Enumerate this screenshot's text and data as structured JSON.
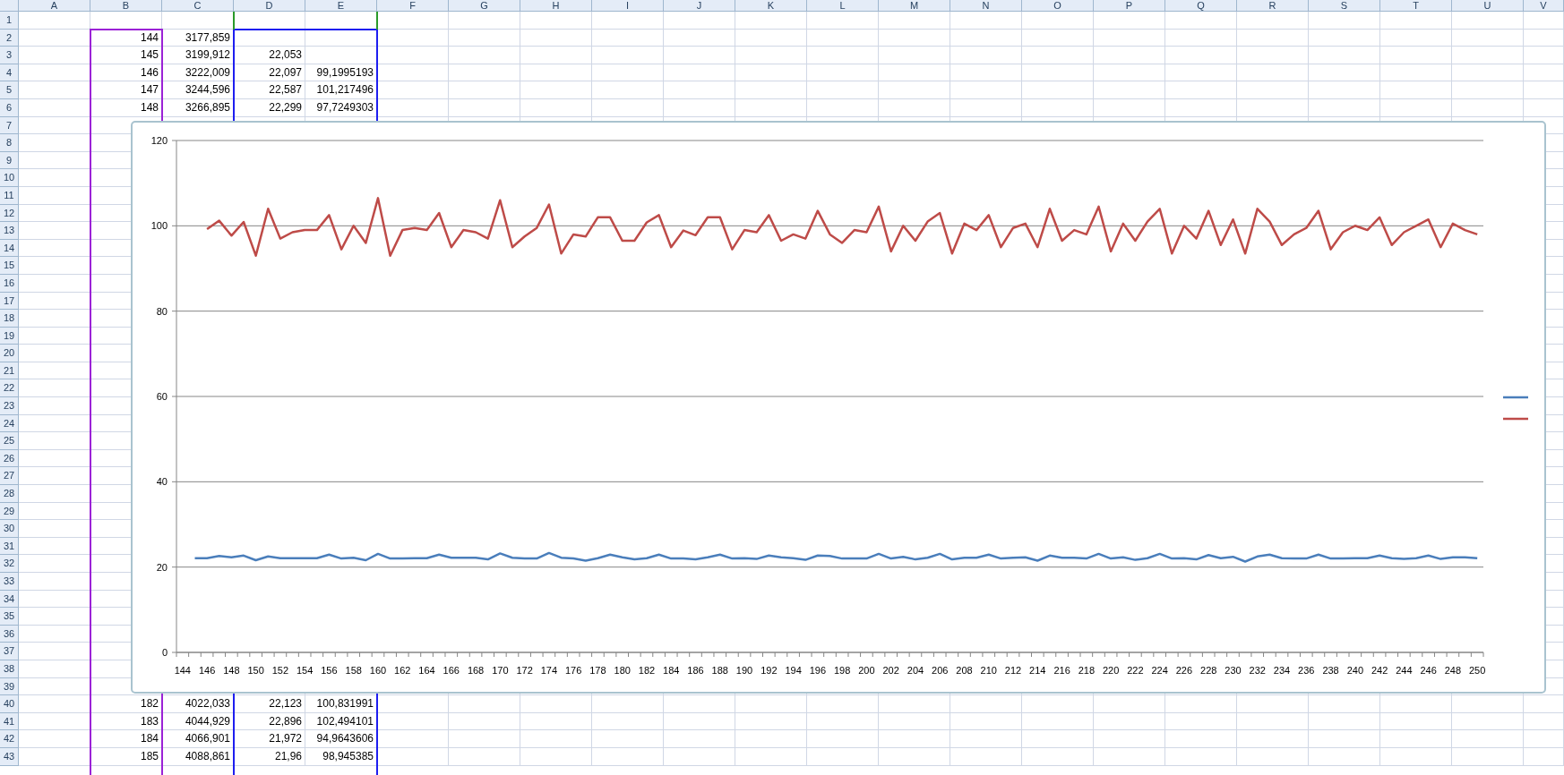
{
  "sheet": {
    "column_headers": [
      "A",
      "B",
      "C",
      "D",
      "E",
      "F",
      "G",
      "H",
      "I",
      "J",
      "K",
      "L",
      "M",
      "N",
      "O",
      "P",
      "Q",
      "R",
      "S",
      "T",
      "U",
      "V"
    ],
    "rows": [
      {
        "header": "1"
      },
      {
        "header": "2",
        "cells": [
          null,
          "144",
          "3177,859"
        ]
      },
      {
        "header": "3",
        "cells": [
          null,
          "145",
          "3199,912",
          "22,053"
        ]
      },
      {
        "header": "4",
        "cells": [
          null,
          "146",
          "3222,009",
          "22,097",
          "99,1995193"
        ]
      },
      {
        "header": "5",
        "cells": [
          null,
          "147",
          "3244,596",
          "22,587",
          "101,217496"
        ]
      },
      {
        "header": "6",
        "cells": [
          null,
          "148",
          "3266,895",
          "22,299",
          "97,7249303"
        ]
      },
      {
        "header": "7"
      },
      {
        "header": "8"
      },
      {
        "header": "9"
      },
      {
        "header": "10"
      },
      {
        "header": "11"
      },
      {
        "header": "12"
      },
      {
        "header": "13"
      },
      {
        "header": "14"
      },
      {
        "header": "15"
      },
      {
        "header": "16"
      },
      {
        "header": "17"
      },
      {
        "header": "18"
      },
      {
        "header": "19"
      },
      {
        "header": "20"
      },
      {
        "header": "21"
      },
      {
        "header": "22"
      },
      {
        "header": "23"
      },
      {
        "header": "24"
      },
      {
        "header": "25"
      },
      {
        "header": "26"
      },
      {
        "header": "27"
      },
      {
        "header": "28"
      },
      {
        "header": "29"
      },
      {
        "header": "30"
      },
      {
        "header": "31"
      },
      {
        "header": "32"
      },
      {
        "header": "33"
      },
      {
        "header": "34"
      },
      {
        "header": "35"
      },
      {
        "header": "36"
      },
      {
        "header": "37"
      },
      {
        "header": "38"
      },
      {
        "header": "39"
      },
      {
        "header": "40",
        "cells": [
          null,
          "182",
          "4022,033",
          "22,123",
          "100,831991"
        ]
      },
      {
        "header": "41",
        "cells": [
          null,
          "183",
          "4044,929",
          "22,896",
          "102,494101"
        ]
      },
      {
        "header": "42",
        "cells": [
          null,
          "184",
          "4066,901",
          "21,972",
          "94,9643606"
        ]
      },
      {
        "header": "43",
        "cells": [
          null,
          "185",
          "4088,861",
          "21,96",
          "98,945385"
        ]
      }
    ]
  },
  "chart": {
    "chart_data": {
      "type": "line",
      "grid": true,
      "xlim": [
        144,
        250
      ],
      "xticks": [
        144,
        146,
        148,
        150,
        152,
        154,
        156,
        158,
        160,
        162,
        164,
        166,
        168,
        170,
        172,
        174,
        176,
        178,
        180,
        182,
        184,
        186,
        188,
        190,
        192,
        194,
        196,
        198,
        200,
        202,
        204,
        206,
        208,
        210,
        212,
        214,
        216,
        218,
        220,
        222,
        224,
        226,
        228,
        230,
        232,
        234,
        236,
        238,
        240,
        242,
        244,
        246,
        248,
        250
      ],
      "x": [
        145,
        146,
        147,
        148,
        149,
        150,
        151,
        152,
        153,
        154,
        155,
        156,
        157,
        158,
        159,
        160,
        161,
        162,
        163,
        164,
        165,
        166,
        167,
        168,
        169,
        170,
        171,
        172,
        173,
        174,
        175,
        176,
        177,
        178,
        179,
        180,
        181,
        182,
        183,
        184,
        185,
        186,
        187,
        188,
        189,
        190,
        191,
        192,
        193,
        194,
        195,
        196,
        197,
        198,
        199,
        200,
        201,
        202,
        203,
        204,
        205,
        206,
        207,
        208,
        209,
        210,
        211,
        212,
        213,
        214,
        215,
        216,
        217,
        218,
        219,
        220,
        221,
        222,
        223,
        224,
        225,
        226,
        227,
        228,
        229,
        230,
        231,
        232,
        233,
        234,
        235,
        236,
        237,
        238,
        239,
        240,
        241,
        242,
        243,
        244,
        245,
        246,
        247,
        248,
        249,
        250
      ],
      "ylim": [
        0,
        120
      ],
      "yticks": [
        0,
        20,
        40,
        60,
        80,
        100,
        120
      ],
      "series": [
        {
          "color": "#4a7ebb",
          "values": [
            22.1,
            22.1,
            22.6,
            22.3,
            22.7,
            21.6,
            22.5,
            22.1,
            22.1,
            22.1,
            22.1,
            22.9,
            22.0,
            22.2,
            21.6,
            23.1,
            22.0,
            22.0,
            22.1,
            22.1,
            22.9,
            22.2,
            22.2,
            22.2,
            21.8,
            23.2,
            22.2,
            22.0,
            22.0,
            23.3,
            22.2,
            22.0,
            21.5,
            22.1,
            22.9,
            22.3,
            21.8,
            22.1,
            22.9,
            22.0,
            22.0,
            21.8,
            22.3,
            22.9,
            22.0,
            22.1,
            21.9,
            22.7,
            22.3,
            22.1,
            21.7,
            22.7,
            22.6,
            22.0,
            22.0,
            22.0,
            23.1,
            22.0,
            22.4,
            21.8,
            22.2,
            23.1,
            21.8,
            22.2,
            22.2,
            22.9,
            22.0,
            22.2,
            22.3,
            21.5,
            22.7,
            22.2,
            22.2,
            22.0,
            23.1,
            22.0,
            22.3,
            21.7,
            22.1,
            23.1,
            22.0,
            22.1,
            21.8,
            22.8,
            22.1,
            22.4,
            21.3,
            22.5,
            22.9,
            22.1,
            22.0,
            22.0,
            22.9,
            22.0,
            22.0,
            22.1,
            22.1,
            22.7,
            22.1,
            21.9,
            22.1,
            22.7,
            21.9,
            22.3,
            22.3,
            22.1
          ]
        },
        {
          "color": "#be4b48",
          "values": [
            null,
            99.2,
            101.2,
            97.7,
            100.9,
            93,
            104,
            97,
            98.5,
            99,
            99,
            102.5,
            94.5,
            100,
            96,
            106.5,
            93,
            99,
            99.5,
            99,
            103,
            95,
            99,
            98.5,
            97,
            106,
            95,
            97.5,
            99.5,
            105,
            93.5,
            98,
            97.5,
            102,
            102,
            96.5,
            96.5,
            100.8,
            102.5,
            95,
            98.9,
            97.8,
            102,
            102,
            94.5,
            99,
            98.5,
            102.5,
            96.5,
            98,
            97,
            103.5,
            98,
            96,
            99,
            98.5,
            104.5,
            94,
            100,
            96.5,
            101,
            103,
            93.5,
            100.5,
            99,
            102.5,
            95,
            99.5,
            100.5,
            95,
            104,
            96.5,
            99,
            98,
            104.5,
            94,
            100.5,
            96.5,
            101,
            104,
            93.5,
            100,
            97,
            103.5,
            95.5,
            101.5,
            93.5,
            104,
            101,
            95.5,
            98,
            99.5,
            103.5,
            94.5,
            98.5,
            100,
            99,
            102,
            95.5,
            98.5,
            100,
            101.5,
            95,
            100.5,
            99,
            98
          ]
        }
      ]
    }
  }
}
